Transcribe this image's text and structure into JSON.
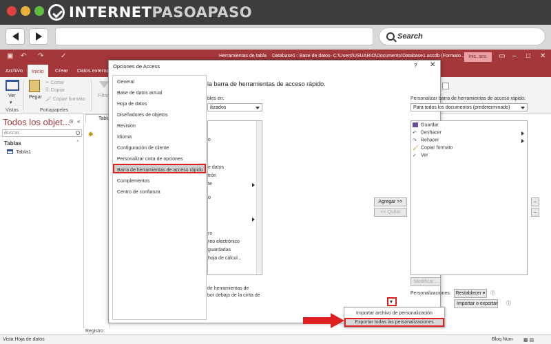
{
  "site": {
    "logo_text": "INTERNETPASOAPASO",
    "logo_part1": "INTERNET",
    "logo_part2": "PASOAPASO"
  },
  "browser": {
    "search_label": "Search",
    "back_icon": "back-arrow-icon",
    "forward_icon": "forward-arrow-icon"
  },
  "access": {
    "tools_context": "Herramientas de tabla",
    "window_title": "Database1 : Base de datos- C:\\Users\\USUARIO\\Documents\\Database1.accdb (Formato...",
    "signin": "Inic. ses.",
    "accent": "#a4373a",
    "tabs": [
      "Archivo",
      "Inicio",
      "Crear",
      "Datos externos"
    ],
    "active_tab": "Inicio",
    "ribbon": {
      "ver": "Ver",
      "pegar": "Pegar",
      "cortar": "Cortar",
      "copiar": "Copiar",
      "copiar_formato": "Copiar formato",
      "filtro": "Filtro",
      "groups": [
        "Vistas",
        "Portapapeles"
      ],
      "formato_texto": "de texto"
    },
    "nav": {
      "title": "Todos los objet...",
      "search_placeholder": "Buscar...",
      "group": "Tablas",
      "item": "Tabla1"
    },
    "doc_tab": "Tabla1",
    "status": {
      "left": "Vista Hoja de datos",
      "right": "Bloq Num",
      "record": "Registro:"
    }
  },
  "dialog": {
    "title": "Opciones de Access",
    "help": "?",
    "categories": [
      "General",
      "Base de datos actual",
      "Hoja de datos",
      "Diseñadores de objetos",
      "Revisión",
      "Idioma",
      "Configuración de cliente",
      "Personalizar cinta de opciones",
      "Barra de herramientas de acceso rápido",
      "Complementos",
      "Centro de confianza"
    ],
    "selected_category": "Barra de herramientas de acceso rápido",
    "heading": "la barra de herramientas de acceso rápido.",
    "left_label": "bles en:",
    "left_dropdown": "ilizados",
    "left_items": [
      "o",
      "",
      "e datos",
      "trón",
      "te",
      "o",
      "",
      "ro",
      "reo electrónico",
      "guardadas",
      "hoja de cálcul..."
    ],
    "left_footer_1": "de herramientas de",
    "left_footer_2": "bor debajo de la cinta de",
    "right_label": "Personalizar barra de herramientas de acceso rápido:",
    "right_dropdown": "Para todos los documentos (predeterminado)",
    "qat_items": [
      "Guardar",
      "Deshacer",
      "Rehacer",
      "Copiar formato",
      "Ver"
    ],
    "add_button": "Agregar >>",
    "remove_button": "<< Quitar",
    "modify_button": "Modificar...",
    "customizations_label": "Personalizaciones:",
    "reset_button": "Restablecer",
    "import_export_button": "Importar o exportar",
    "menu": [
      "Importar archivo de personalización",
      "Exportar todas las personalizaciones"
    ],
    "highlight_color": "#e02020"
  }
}
